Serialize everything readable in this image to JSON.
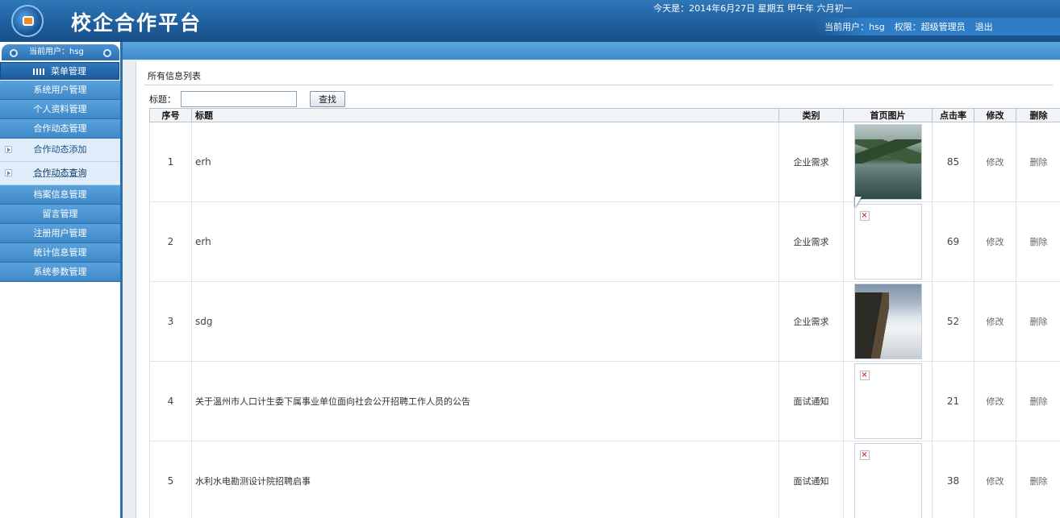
{
  "header": {
    "title": "校企合作平台",
    "date_line": "今天是：2014年6月27日 星期五 甲午年 六月初一",
    "current_user": "当前用户：hsg",
    "permission": "权限：超级管理员",
    "logout": "退出"
  },
  "sidebar": {
    "current_user": "当前用户：hsg",
    "menu_head": "菜单管理",
    "items": [
      {
        "label": "系统用户管理",
        "type": "item"
      },
      {
        "label": "个人资料管理",
        "type": "item"
      },
      {
        "label": "合作动态管理",
        "type": "item"
      },
      {
        "label": "合作动态添加",
        "type": "sub"
      },
      {
        "label": "合作动态查询",
        "type": "sub"
      },
      {
        "label": "档案信息管理",
        "type": "item"
      },
      {
        "label": "留言管理",
        "type": "item"
      },
      {
        "label": "注册用户管理",
        "type": "item"
      },
      {
        "label": "统计信息管理",
        "type": "item"
      },
      {
        "label": "系统参数管理",
        "type": "item"
      }
    ]
  },
  "main": {
    "panel_title": "所有信息列表",
    "search": {
      "label": "标题：",
      "value": "",
      "button": "查找"
    },
    "columns": [
      "序号",
      "标题",
      "类别",
      "首页图片",
      "点击率",
      "修改",
      "删除"
    ],
    "rows": [
      {
        "no": "1",
        "title": "erh",
        "category": "企业需求",
        "image": "lake",
        "clicks": "85",
        "edit": "修改",
        "delete": "删除"
      },
      {
        "no": "2",
        "title": "erh",
        "category": "企业需求",
        "image": "broken",
        "clicks": "69",
        "edit": "修改",
        "delete": "删除"
      },
      {
        "no": "3",
        "title": "sdg",
        "category": "企业需求",
        "image": "mist",
        "clicks": "52",
        "edit": "修改",
        "delete": "删除"
      },
      {
        "no": "4",
        "title": "关于温州市人口计生委下属事业单位面向社会公开招聘工作人员的公告",
        "category": "面试通知",
        "image": "broken",
        "clicks": "21",
        "edit": "修改",
        "delete": "删除"
      },
      {
        "no": "5",
        "title": "水利水电勘测设计院招聘启事",
        "category": "面试通知",
        "image": "broken",
        "clicks": "38",
        "edit": "修改",
        "delete": "删除"
      }
    ]
  }
}
